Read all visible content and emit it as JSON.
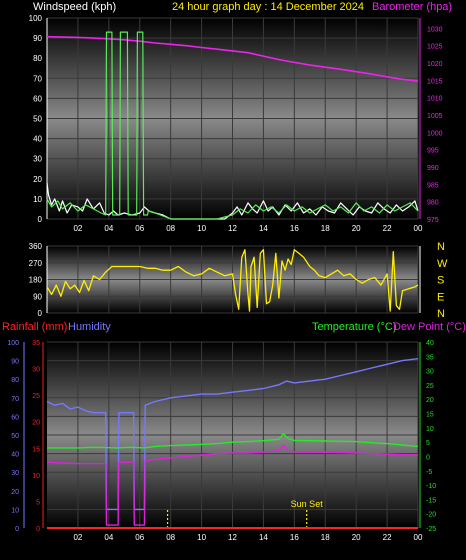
{
  "header": {
    "left_label": "Windspeed (kph)",
    "center_label": "24 hour graph day : 14 December 2024",
    "right_label": "Barometer (hpa)"
  },
  "colors": {
    "windspeed": "#ffffff",
    "gust": "#55ee55",
    "barometer": "#ee22ee",
    "direction": "#ffee00",
    "rainfall": "#ff2222",
    "humidity": "#7777ff",
    "temperature": "#22ee22",
    "dew_point": "#dd22dd",
    "sunset_marker": "#ffee00",
    "sunrise_marker": "#ffee00",
    "text_default": "#ffffff",
    "temp_axis": "#22dd22",
    "baro_axis": "#ee22ee",
    "rain_axis": "#ee2222",
    "hum_axis": "#7777ff",
    "dir_axis": "#ffee00"
  },
  "chart_data": [
    {
      "id": "wind",
      "type": "line",
      "title": "24 hour graph day : 14 December 2024",
      "xlabel": "",
      "x_ticks": [
        "02",
        "04",
        "06",
        "08",
        "10",
        "12",
        "14",
        "16",
        "18",
        "20",
        "22",
        "00"
      ],
      "x_range": [
        0,
        24
      ],
      "left_axis": {
        "label": "Windspeed (kph)",
        "range": [
          0,
          100
        ],
        "ticks": [
          0,
          10,
          20,
          30,
          40,
          50,
          60,
          70,
          80,
          90,
          100
        ]
      },
      "right_axis": {
        "label": "Barometer (hpa)",
        "range": [
          975,
          1033
        ],
        "ticks": [
          975,
          980,
          985,
          990,
          995,
          1000,
          1005,
          1010,
          1015,
          1020,
          1025,
          1030
        ]
      },
      "series": [
        {
          "name": "Barometer",
          "axis": "right",
          "x": [
            0,
            1,
            2,
            3,
            4,
            5,
            6,
            7,
            8,
            9,
            10,
            11,
            12,
            13,
            14,
            15,
            16,
            17,
            18,
            19,
            20,
            21,
            22,
            23,
            24
          ],
          "y": [
            1027.6,
            1027.5,
            1027.4,
            1027.2,
            1027,
            1026.7,
            1026.3,
            1025.8,
            1025.4,
            1025.0,
            1024.5,
            1024.0,
            1023.5,
            1023.0,
            1022.0,
            1021.0,
            1020.2,
            1019.4,
            1018.8,
            1018.2,
            1017.5,
            1016.8,
            1016.0,
            1015.3,
            1014.8
          ]
        },
        {
          "name": "Windspeed",
          "axis": "left",
          "x": [
            0,
            0.1,
            0.3,
            0.5,
            0.8,
            1,
            1.3,
            1.6,
            2,
            2.3,
            2.6,
            3,
            3.4,
            3.7,
            4,
            4.3,
            4.6,
            5,
            5.5,
            6,
            6.3,
            6.6,
            7,
            7.5,
            8,
            9,
            10,
            11,
            11.5,
            12,
            12.3,
            12.6,
            13,
            13.3,
            13.6,
            14,
            14.3,
            14.6,
            15,
            15.4,
            15.8,
            16.2,
            16.6,
            17,
            17.4,
            17.8,
            18.2,
            18.6,
            19,
            19.4,
            19.8,
            20.2,
            20.6,
            21,
            21.4,
            21.8,
            22.2,
            22.6,
            23,
            23.4,
            23.8,
            24
          ],
          "y": [
            18,
            12,
            7,
            10,
            4,
            9,
            3,
            7,
            6,
            4,
            10,
            5,
            8,
            3,
            2,
            4,
            2,
            3,
            2,
            3,
            6,
            4,
            3,
            2,
            0,
            0,
            0,
            0,
            0,
            3,
            6,
            2,
            8,
            5,
            3,
            9,
            4,
            6,
            2,
            7,
            4,
            8,
            3,
            5,
            2,
            6,
            4,
            3,
            8,
            5,
            2,
            6,
            4,
            3,
            8,
            5,
            3,
            7,
            4,
            6,
            9,
            4
          ]
        },
        {
          "name": "Gust",
          "axis": "left",
          "x": [
            0,
            0.3,
            0.7,
            1,
            1.5,
            2,
            2.5,
            3,
            3.5,
            3.8,
            3.85,
            4.2,
            4.25,
            4.7,
            4.75,
            5.2,
            5.25,
            5.8,
            5.85,
            6.2,
            6.25,
            6.5,
            6.55,
            7,
            8,
            9,
            10,
            11,
            12,
            12.5,
            13,
            13.5,
            14,
            14.5,
            15,
            15.5,
            16,
            16.5,
            17,
            17.5,
            18,
            18.5,
            19,
            19.5,
            20,
            20.5,
            21,
            21.5,
            22,
            22.5,
            23,
            23.5,
            24
          ],
          "y": [
            10,
            6,
            9,
            5,
            8,
            4,
            7,
            5,
            3,
            2,
            93,
            93,
            2,
            2,
            93,
            93,
            2,
            2,
            93,
            93,
            2,
            2,
            4,
            3,
            0,
            0,
            0,
            0,
            2,
            5,
            3,
            7,
            4,
            6,
            3,
            7,
            4,
            6,
            3,
            5,
            7,
            4,
            6,
            3,
            8,
            4,
            6,
            3,
            7,
            4,
            6,
            8,
            4
          ]
        }
      ]
    },
    {
      "id": "direction",
      "type": "line",
      "xlabel": "",
      "x_range": [
        0,
        24
      ],
      "left_axis": {
        "range": [
          0,
          360
        ],
        "ticks": [
          0,
          90,
          180,
          270,
          360
        ]
      },
      "right_labels": [
        "N",
        "W",
        "S",
        "E",
        "N"
      ],
      "series": [
        {
          "name": "Wind Direction",
          "x": [
            0,
            0.3,
            0.6,
            0.9,
            1.2,
            1.5,
            1.8,
            2.1,
            2.4,
            2.7,
            3,
            3.4,
            3.8,
            4.2,
            4.6,
            5,
            5.5,
            6,
            6.5,
            7,
            7.5,
            8,
            8.5,
            9,
            9.5,
            10,
            10.5,
            11,
            11.5,
            12,
            12.2,
            12.4,
            12.6,
            12.8,
            13,
            13.1,
            13.2,
            13.4,
            13.6,
            13.8,
            14,
            14.2,
            14.4,
            14.6,
            14.8,
            15,
            15.2,
            15.4,
            15.6,
            15.8,
            16,
            16.3,
            16.6,
            17,
            17.3,
            17.6,
            18,
            18.4,
            18.8,
            19.2,
            19.6,
            20,
            20.4,
            20.8,
            21.2,
            21.6,
            22,
            22.2,
            22.4,
            22.6,
            22.8,
            23,
            23.4,
            23.8,
            24
          ],
          "y": [
            140,
            100,
            150,
            90,
            170,
            130,
            150,
            110,
            175,
            120,
            200,
            180,
            220,
            250,
            250,
            250,
            250,
            250,
            240,
            240,
            230,
            230,
            250,
            220,
            200,
            210,
            240,
            220,
            200,
            210,
            100,
            20,
            300,
            340,
            100,
            10,
            250,
            300,
            30,
            320,
            340,
            50,
            60,
            150,
            320,
            80,
            280,
            230,
            290,
            260,
            340,
            320,
            300,
            250,
            230,
            200,
            190,
            210,
            230,
            200,
            210,
            180,
            160,
            180,
            190,
            150,
            210,
            10,
            330,
            40,
            20,
            120,
            130,
            140,
            150
          ]
        }
      ]
    },
    {
      "id": "temp",
      "type": "line",
      "xlabel": "",
      "x_ticks": [
        "02",
        "04",
        "06",
        "08",
        "10",
        "12",
        "14",
        "16",
        "18",
        "20",
        "22",
        "00"
      ],
      "x_range": [
        0,
        24
      ],
      "labels": {
        "rainfall": "Rainfall (mm)",
        "humidity": "Humidity",
        "temperature": "Temperature (°C)",
        "dew_point": "Dew Point (°C)"
      },
      "hum_axis": {
        "range": [
          0,
          100
        ],
        "ticks": [
          0,
          10,
          20,
          30,
          40,
          50,
          60,
          70,
          80,
          90,
          100
        ]
      },
      "rain_axis": {
        "range": [
          0,
          35
        ],
        "ticks": [
          0,
          5,
          10,
          15,
          20,
          25,
          30,
          35
        ]
      },
      "temp_axis": {
        "range": [
          -25,
          40
        ],
        "ticks": [
          -25,
          -20,
          -15,
          -10,
          -5,
          0,
          5,
          10,
          15,
          20,
          25,
          30,
          35,
          40
        ]
      },
      "series": [
        {
          "name": "Humidity",
          "axis": "hum",
          "x": [
            0,
            0.5,
            1,
            1.5,
            2,
            2.5,
            3,
            3.5,
            3.8,
            3.85,
            4.6,
            4.65,
            5.6,
            5.65,
            6.3,
            6.35,
            7,
            8,
            9,
            10,
            11,
            12,
            13,
            14,
            15,
            15.5,
            16,
            17,
            18,
            19,
            20,
            21,
            22,
            23,
            24
          ],
          "y": [
            68,
            66,
            67,
            64,
            65,
            63,
            62,
            62,
            62,
            10,
            10,
            62,
            62,
            10,
            10,
            66,
            68,
            70,
            71,
            72,
            72,
            73,
            74,
            75,
            77,
            79,
            78,
            79,
            80,
            82,
            84,
            86,
            88,
            90,
            91
          ]
        },
        {
          "name": "Temperature",
          "axis": "temp",
          "x": [
            0,
            1,
            2,
            3,
            3.8,
            4.5,
            5.5,
            6.3,
            7,
            8,
            9,
            10,
            11,
            12,
            13,
            14,
            15,
            15.3,
            15.6,
            16,
            17,
            18,
            19,
            20,
            21,
            22,
            23,
            24
          ],
          "y": [
            3,
            3,
            3,
            3.2,
            3.1,
            3,
            3.2,
            3,
            3.5,
            3.8,
            4,
            4.2,
            4.5,
            5,
            5.2,
            5.5,
            6,
            8,
            6.2,
            5.6,
            5.5,
            5.4,
            5.3,
            5.2,
            4.8,
            4.5,
            4,
            3.5
          ]
        },
        {
          "name": "Dew Point",
          "axis": "temp",
          "x": [
            0,
            1,
            2,
            3,
            3.8,
            3.85,
            4.6,
            4.65,
            5.6,
            5.65,
            6.3,
            6.35,
            7,
            8,
            9,
            10,
            11,
            12,
            13,
            14,
            15,
            15.3,
            15.6,
            16,
            17,
            18,
            19,
            20,
            21,
            22,
            23,
            24
          ],
          "y": [
            -2,
            -2.3,
            -2.5,
            -2.5,
            -2.5,
            -24,
            -24,
            -2,
            -2,
            -24,
            -24,
            -1.5,
            -1,
            -0.5,
            0,
            0.5,
            1,
            1.2,
            1.2,
            1.5,
            2,
            4,
            1.8,
            1.6,
            1.5,
            1.5,
            1.4,
            1.2,
            1,
            0.8,
            0.6,
            0.5
          ]
        },
        {
          "name": "Rainfall",
          "axis": "rain",
          "x": [
            0,
            24
          ],
          "y": [
            0,
            0
          ]
        }
      ],
      "markers": [
        {
          "name": "Sun Rise",
          "label": "",
          "x": 7.8
        },
        {
          "name": "Sun Set",
          "label": "Sun Set",
          "x": 16.8
        }
      ]
    }
  ]
}
